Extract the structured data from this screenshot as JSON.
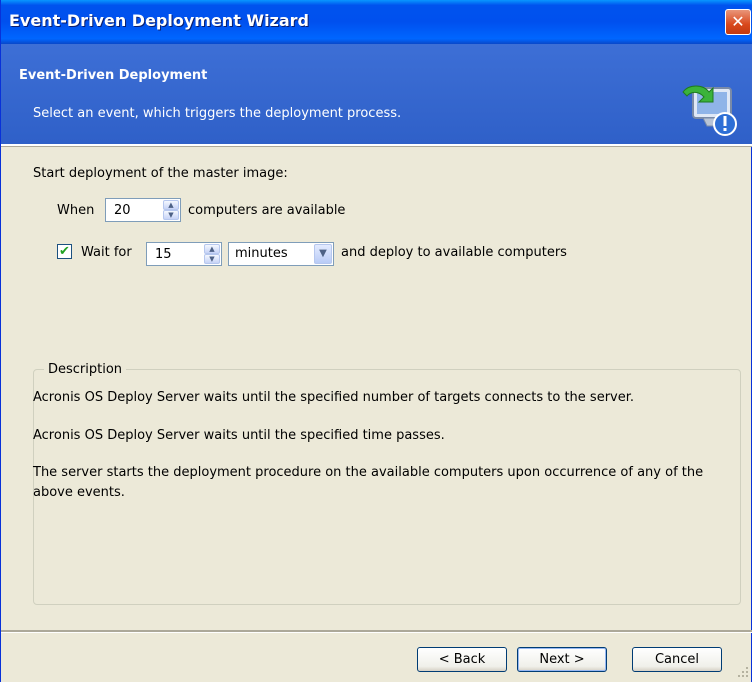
{
  "window": {
    "title": "Event-Driven Deployment Wizard",
    "close_glyph": "✕"
  },
  "header": {
    "title": "Event-Driven Deployment",
    "subtitle": "Select an event, which triggers the deployment process.",
    "icon": "monitor-download-icon"
  },
  "main": {
    "start_label": "Start deployment of the master image:",
    "when_label": "When",
    "computers_value": "20",
    "computers_suffix": "computers are available",
    "wait_checked": true,
    "wait_check_glyph": "✔",
    "wait_label": "Wait for",
    "wait_value": "15",
    "wait_unit": "minutes",
    "wait_suffix": "and deploy to available computers"
  },
  "description": {
    "legend": "Description",
    "line1": "Acronis OS Deploy Server waits until the specified number of targets connects to the server.",
    "line2": "Acronis OS Deploy Server waits until the specified time passes.",
    "line3": "The server starts the deployment procedure on the available computers upon occurrence of any of the above events."
  },
  "buttons": {
    "back": "< Back",
    "next": "Next >",
    "cancel": "Cancel"
  },
  "colors": {
    "titlebar": "#0054e3",
    "header": "#3366cc",
    "dialog_bg": "#ece9d8",
    "close": "#d9481c"
  }
}
